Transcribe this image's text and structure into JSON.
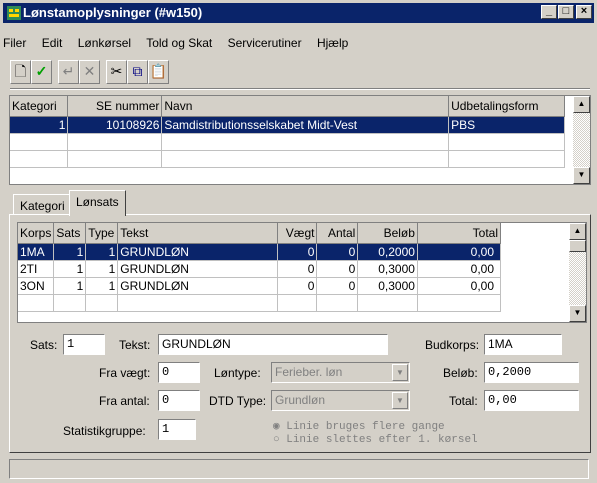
{
  "window": {
    "title": "Lønstamoplysninger (#w150)",
    "min_label": "_",
    "max_label": "□",
    "close_label": "×"
  },
  "menu": [
    "Filer",
    "Edit",
    "Lønkørsel",
    "Told og Skat",
    "Servicerutiner",
    "Hjælp"
  ],
  "toolbar": {
    "new": "🗋",
    "ok": "✓",
    "undo": "↵",
    "delete": "✕",
    "cut": "✂",
    "copy": "⧉",
    "paste": "📋"
  },
  "top_grid": {
    "columns": [
      "Kategori",
      "SE nummer",
      "Navn",
      "Udbetalingsform"
    ],
    "rows": [
      {
        "kategori": "1",
        "se": "10108926",
        "navn": "Samdistributionsselskabet Midt-Vest",
        "udbetaling": "PBS"
      }
    ]
  },
  "tabs": {
    "kategori": "Kategori",
    "lonsats": "Lønsats"
  },
  "bottom_grid": {
    "columns": [
      "Korps",
      "Sats",
      "Type",
      "Tekst",
      "Vægt",
      "Antal",
      "Beløb",
      "Total"
    ],
    "rows": [
      {
        "korps": "1MA",
        "sats": "1",
        "type": "1",
        "tekst": "GRUNDLØN",
        "vaegt": "0",
        "antal": "0",
        "belob": "0,2000",
        "total": "0,00"
      },
      {
        "korps": "2TI",
        "sats": "1",
        "type": "1",
        "tekst": "GRUNDLØN",
        "vaegt": "0",
        "antal": "0",
        "belob": "0,3000",
        "total": "0,00"
      },
      {
        "korps": "3ON",
        "sats": "1",
        "type": "1",
        "tekst": "GRUNDLØN",
        "vaegt": "0",
        "antal": "0",
        "belob": "0,3000",
        "total": "0,00"
      }
    ]
  },
  "form": {
    "sats_label": "Sats:",
    "sats_value": "1",
    "tekst_label": "Tekst:",
    "tekst_value": "GRUNDLØN",
    "budkorps_label": "Budkorps:",
    "budkorps_value": "1MA",
    "fravaegt_label": "Fra vægt:",
    "fravaegt_value": "0",
    "lontype_label": "Løntype:",
    "lontype_value": "Ferieber. løn",
    "belob_label": "Beløb:",
    "belob_value": "0,2000",
    "fraantal_label": "Fra antal:",
    "fraantal_value": "0",
    "dtdtype_label": "DTD Type:",
    "dtdtype_value": "Grundløn",
    "total_label": "Total:",
    "total_value": "0,00",
    "statistik_label": "Statistikgruppe:",
    "statistik_value": "1",
    "radio1": "Linie bruges flere gange",
    "radio2": "Linie slettes efter 1. kørsel"
  }
}
